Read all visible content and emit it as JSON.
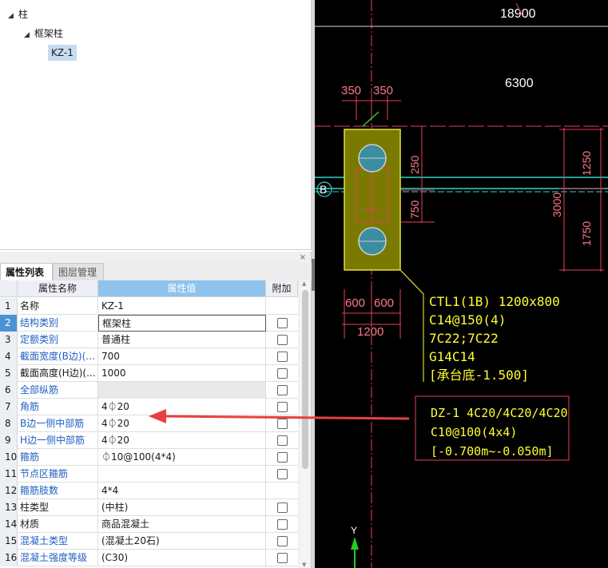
{
  "tree": {
    "root": "柱",
    "child": "框架柱",
    "leaf": "KZ-1"
  },
  "panel": {
    "tabs": [
      "属性列表",
      "图层管理"
    ],
    "close_glyph": "×",
    "headers": {
      "name": "属性名称",
      "value": "属性值",
      "extra": "附加"
    },
    "rows": [
      {
        "num": "1",
        "name": "名称",
        "value": "KZ-1",
        "check": false
      },
      {
        "num": "2",
        "name": "结构类别",
        "value": "框架柱",
        "check": true
      },
      {
        "num": "3",
        "name": "定额类别",
        "value": "普通柱",
        "check": true
      },
      {
        "num": "4",
        "name": "截面宽度(B边)(...",
        "value": "700",
        "check": true
      },
      {
        "num": "5",
        "name": "截面高度(H边)(...",
        "value": "1000",
        "check": true
      },
      {
        "num": "6",
        "name": "全部纵筋",
        "value": "",
        "check": true
      },
      {
        "num": "7",
        "name": "角筋",
        "value": "4⏀20",
        "check": true
      },
      {
        "num": "8",
        "name": "B边一侧中部筋",
        "value": "4⏀20",
        "check": true
      },
      {
        "num": "9",
        "name": "H边一侧中部筋",
        "value": "4⏀20",
        "check": true
      },
      {
        "num": "10",
        "name": "箍筋",
        "value": "⏀10@100(4*4)",
        "check": true
      },
      {
        "num": "11",
        "name": "节点区箍筋",
        "value": "",
        "check": true
      },
      {
        "num": "12",
        "name": "箍筋肢数",
        "value": "4*4",
        "check": false
      },
      {
        "num": "13",
        "name": "柱类型",
        "value": "(中柱)",
        "check": true
      },
      {
        "num": "14",
        "name": "材质",
        "value": "商品混凝土",
        "check": true
      },
      {
        "num": "15",
        "name": "混凝土类型",
        "value": "(混凝土20石)",
        "check": true
      },
      {
        "num": "16",
        "name": "混凝土强度等级",
        "value": "(C30)",
        "check": true
      }
    ]
  },
  "cad": {
    "dims": {
      "top_total": "18900",
      "span": "6300",
      "d350a": "350",
      "d350b": "350",
      "d250": "250",
      "d750": "750",
      "d1250": "1250",
      "d3000": "3000",
      "d1750": "1750",
      "d600a": "600",
      "d600b": "600",
      "d1200": "1200"
    },
    "axis_label": "B",
    "cap_note": [
      "CTL1(1B) 1200x800",
      "C14@150(4)",
      "7C22;7C22",
      "G14C14",
      "[承台底-1.500]"
    ],
    "col_note": [
      "DZ-1 4C20/4C20/4C20",
      "C10@100(4x4)",
      "[-0.700m~-0.050m]"
    ],
    "ucs_y": "Y",
    "colors": {
      "cad_bg": "#000000",
      "cap_fill": "#7a7a00",
      "pile": "#3a8ea0",
      "dim": "#e8405a",
      "note": "#ffff33",
      "grid_cyan": "#2fd3c8",
      "arrow": "#e84040",
      "selected_row": "#4c93d6"
    }
  }
}
